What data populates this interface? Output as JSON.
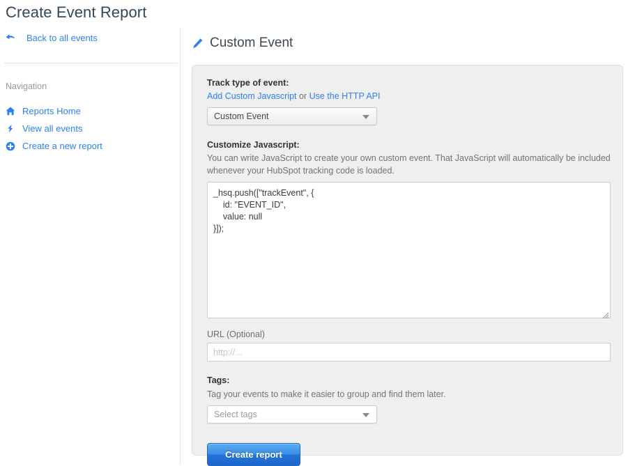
{
  "page": {
    "title": "Create Event Report"
  },
  "sidebar": {
    "back_link": {
      "label": "Back to all events",
      "icon": "back-arrow-icon"
    },
    "nav_heading": "Navigation",
    "items": [
      {
        "label": "Reports Home",
        "icon": "home-icon"
      },
      {
        "label": "View all events",
        "icon": "lightning-bolt-icon"
      },
      {
        "label": "Create a new report",
        "icon": "plus-circle-icon"
      }
    ]
  },
  "main": {
    "panel_title": "Custom Event",
    "panel_title_icon": "pencil-icon",
    "track_type": {
      "label": "Track type of event:",
      "link_custom_js": "Add Custom Javascript",
      "separator": " or ",
      "link_http_api": "Use the HTTP API",
      "select_value": "Custom Event"
    },
    "customize_js": {
      "label": "Customize Javascript:",
      "help": "You can write JavaScript to create your own custom event. That JavaScript will automatically be included whenever your HubSpot tracking code is loaded.",
      "code": "_hsq.push([\"trackEvent\", {\n    id: \"EVENT_ID\",\n    value: null\n}]);"
    },
    "url": {
      "label": "URL (Optional)",
      "value": "",
      "placeholder": "http://..."
    },
    "tags": {
      "label": "Tags:",
      "help": "Tag your events to make it easier to group and find them later.",
      "select_value": "Select tags"
    },
    "submit_label": "Create report"
  },
  "colors": {
    "link_blue": "#2d7ff9",
    "button_blue": "#2273d8",
    "panel_bg": "#efefef",
    "title_gray": "#33475b"
  }
}
